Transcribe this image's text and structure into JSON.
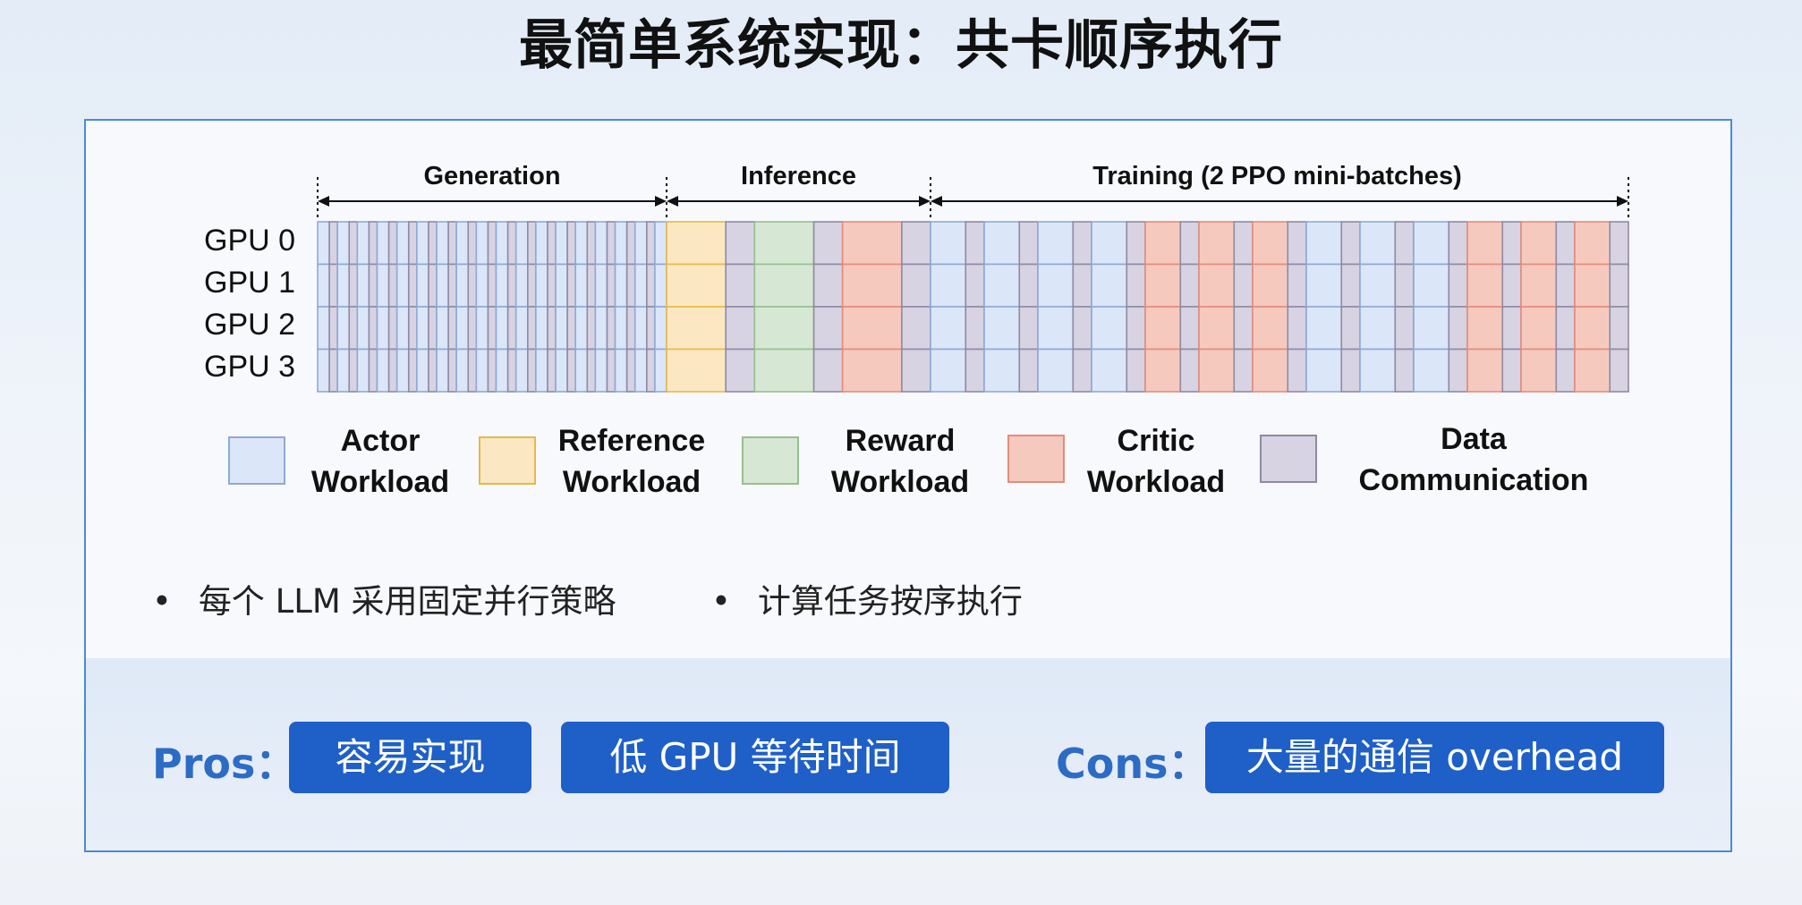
{
  "title": "最简单系统实现：共卡顺序执行",
  "diagram": {
    "phases": [
      "Generation",
      "Inference",
      "Training (2 PPO mini-batches)"
    ],
    "gpus": [
      "GPU 0",
      "GPU 1",
      "GPU 2",
      "GPU 3"
    ],
    "workload_sequence": [
      "actor",
      "comm",
      "actor",
      "comm",
      "actor",
      "comm",
      "actor",
      "comm",
      "actor",
      "comm",
      "actor",
      "comm",
      "actor",
      "comm",
      "actor",
      "comm",
      "actor",
      "comm",
      "actor",
      "comm",
      "actor",
      "comm",
      "actor",
      "comm",
      "actor",
      "comm",
      "actor",
      "comm",
      "actor",
      "comm",
      "actor",
      "comm",
      "actor",
      "comm",
      "actor",
      "reference",
      "comm",
      "reward",
      "comm",
      "critic",
      "comm",
      "actor",
      "comm",
      "actor",
      "comm",
      "actor",
      "comm",
      "actor",
      "comm",
      "critic",
      "comm",
      "critic",
      "comm",
      "critic",
      "comm",
      "actor",
      "comm",
      "actor",
      "comm",
      "actor",
      "comm",
      "critic",
      "comm",
      "critic",
      "comm",
      "critic",
      "comm"
    ],
    "colors": {
      "actor": {
        "fill": "#dbe7f8",
        "stroke": "#8fa9d6"
      },
      "reference": {
        "fill": "#fbe8c2",
        "stroke": "#e5b94a"
      },
      "reward": {
        "fill": "#d6e8d3",
        "stroke": "#96bf8e"
      },
      "critic": {
        "fill": "#f6c9bf",
        "stroke": "#e58c7a"
      },
      "comm": {
        "fill": "#d8d3e3",
        "stroke": "#8e8aa3"
      }
    }
  },
  "legend": [
    {
      "key": "actor",
      "line1": "Actor",
      "line2": "Workload"
    },
    {
      "key": "reference",
      "line1": "Reference",
      "line2": "Workload"
    },
    {
      "key": "reward",
      "line1": "Reward",
      "line2": "Workload"
    },
    {
      "key": "critic",
      "line1": "Critic",
      "line2": "Workload"
    },
    {
      "key": "comm",
      "line1": "Data",
      "line2": "Communication"
    }
  ],
  "bullets": [
    "每个 LLM 采用固定并行策略",
    "计算任务按序执行"
  ],
  "bullet_symbol": "•",
  "pros": {
    "label": "Pros：",
    "items": [
      "容易实现",
      "低 GPU 等待时间"
    ]
  },
  "cons": {
    "label": "Cons：",
    "items": [
      "大量的通信 overhead"
    ]
  }
}
